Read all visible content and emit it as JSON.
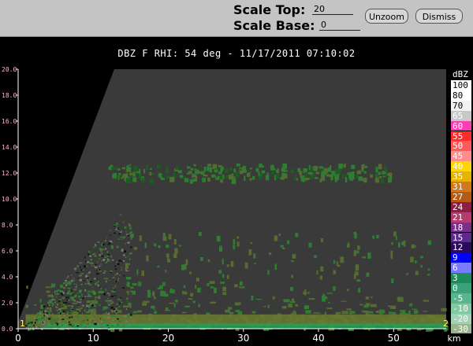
{
  "toolbar": {
    "scale_top_label": "Scale Top:",
    "scale_top_value": "20",
    "scale_base_label": "Scale Base:",
    "scale_base_value": "0",
    "unzoom_label": "Unzoom",
    "dismiss_label": "Dismiss"
  },
  "plot": {
    "title": "DBZ F  RHI: 54 deg  -  11/17/2011 07:10:02",
    "background_color": "#3a3a3a",
    "blocked_color": "#000000",
    "x_unit_label": "km",
    "corner_label_left": "1",
    "corner_label_right": "2"
  },
  "chart_data": {
    "type": "heatmap",
    "title": "DBZ F  RHI: 54 deg  -  11/17/2011 07:10:02",
    "xlabel": "km",
    "ylabel": "",
    "xlim": [
      0,
      57
    ],
    "ylim": [
      0,
      20
    ],
    "x_ticks": [
      0,
      10,
      20,
      30,
      40,
      50
    ],
    "y_ticks": [
      "0.0",
      "2.0",
      "4.0",
      "6.0",
      "8.0",
      "10.0",
      "12.0",
      "14.0",
      "16.0",
      "18.0",
      "20.0"
    ],
    "legend": {
      "title": "dBZ",
      "entries": [
        {
          "label": "100",
          "color": "#ffffff"
        },
        {
          "label": "80",
          "color": "#ffffff"
        },
        {
          "label": "70",
          "color": "#f2f2f2"
        },
        {
          "label": "65",
          "color": "#c8c8c8"
        },
        {
          "label": "60",
          "color": "#ff3cb4"
        },
        {
          "label": "55",
          "color": "#ff2a2a"
        },
        {
          "label": "50",
          "color": "#ff5a5a"
        },
        {
          "label": "45",
          "color": "#ff8c8c"
        },
        {
          "label": "40",
          "color": "#ffd700"
        },
        {
          "label": "35",
          "color": "#e6b400"
        },
        {
          "label": "31",
          "color": "#d2781e"
        },
        {
          "label": "27",
          "color": "#b45a14"
        },
        {
          "label": "24",
          "color": "#8c1e46"
        },
        {
          "label": "21",
          "color": "#b43c6e"
        },
        {
          "label": "18",
          "color": "#7a2e8c"
        },
        {
          "label": "15",
          "color": "#5a2a8c"
        },
        {
          "label": "12",
          "color": "#2a0a5a"
        },
        {
          "label": "9",
          "color": "#0000ff"
        },
        {
          "label": "6",
          "color": "#7a7aff"
        },
        {
          "label": "3",
          "color": "#1e8c5a"
        },
        {
          "label": "0",
          "color": "#3ca078"
        },
        {
          "label": "-5",
          "color": "#5ab48c"
        },
        {
          "label": "-10",
          "color": "#82c8a0"
        },
        {
          "label": "-20",
          "color": "#a0d2b4"
        },
        {
          "label": "-30",
          "color": "#9ab48c"
        }
      ]
    },
    "echo_regions": [
      {
        "name": "upper layer",
        "x_range": [
          12,
          50
        ],
        "y_range": [
          11.5,
          13.0
        ],
        "color": "#2f7a2f"
      },
      {
        "name": "near-surface layer",
        "x_range": [
          1,
          57
        ],
        "y_range": [
          0,
          3.5
        ],
        "color": "#4a6a2a"
      },
      {
        "name": "near-radar clutter",
        "x_range": [
          1,
          15
        ],
        "y_range": [
          0,
          9
        ],
        "color": "#2f7a2f"
      }
    ]
  }
}
